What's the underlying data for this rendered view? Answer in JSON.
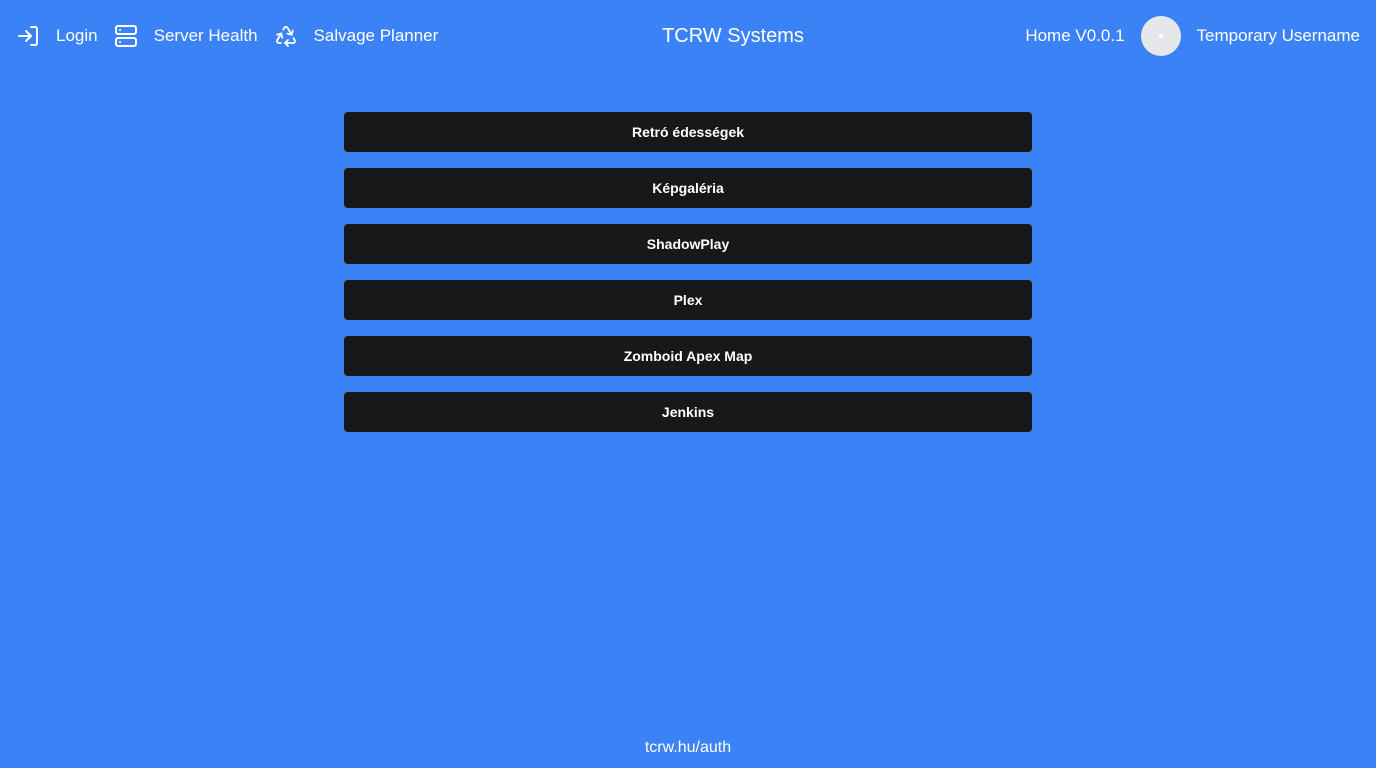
{
  "header": {
    "nav": [
      {
        "label": "Login",
        "icon": "login-icon"
      },
      {
        "label": "Server Health",
        "icon": "server-icon"
      },
      {
        "label": "Salvage Planner",
        "icon": "recycle-icon"
      }
    ],
    "title": "TCRW Systems",
    "version": "Home V0.0.1",
    "username": "Temporary Username"
  },
  "links": [
    {
      "label": "Retró édességek"
    },
    {
      "label": "Képgaléria"
    },
    {
      "label": "ShadowPlay"
    },
    {
      "label": "Plex"
    },
    {
      "label": "Zomboid Apex Map"
    },
    {
      "label": "Jenkins"
    }
  ],
  "footer": {
    "text": "tcrw.hu/auth"
  },
  "colors": {
    "background": "#3b82f6",
    "button": "#18181b",
    "text": "#ffffff",
    "avatar": "#e5e7eb"
  }
}
